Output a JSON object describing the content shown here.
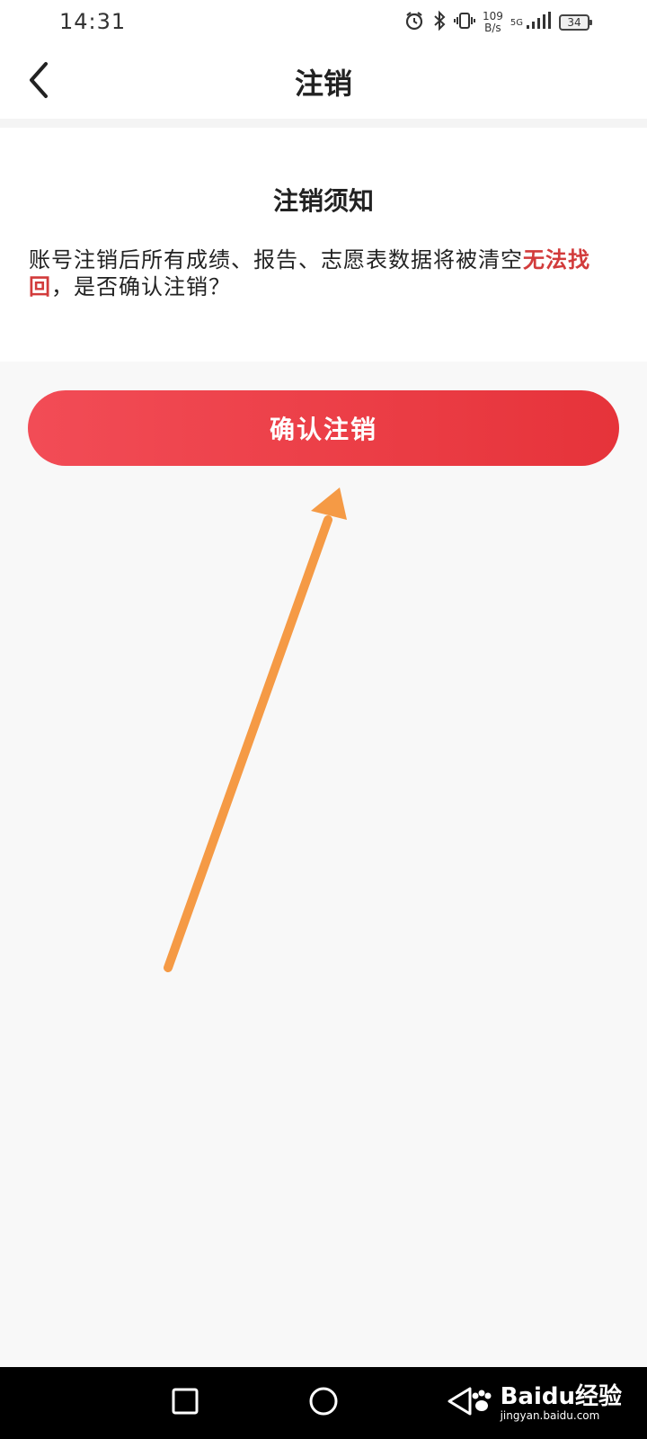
{
  "status_bar": {
    "time": "14:31",
    "speed_value": "109",
    "speed_unit": "B/s",
    "network": "5G",
    "battery": "34",
    "icons": [
      "alarm-icon",
      "bluetooth-icon",
      "vibrate-icon",
      "signal-icon",
      "battery-icon"
    ]
  },
  "header": {
    "title": "注销",
    "back_icon": "chevron-left-icon"
  },
  "notice": {
    "title": "注销须知",
    "body_prefix": "账号注销后所有成绩、报告、志愿表数据将被清空",
    "body_warning": "无法找回",
    "body_suffix": "，是否确认注销？"
  },
  "confirm_button": {
    "label": "确认注销"
  },
  "nav_bar": {
    "buttons": [
      "recents-square-icon",
      "home-circle-icon",
      "back-triangle-icon"
    ]
  },
  "watermark": {
    "brand": "Baidu经验",
    "url": "jingyan.baidu.com"
  },
  "colors": {
    "accent": "#e6333a",
    "warning_text": "#d23b3b",
    "annotation_arrow": "#f59a45",
    "background": "#f8f8f8"
  }
}
